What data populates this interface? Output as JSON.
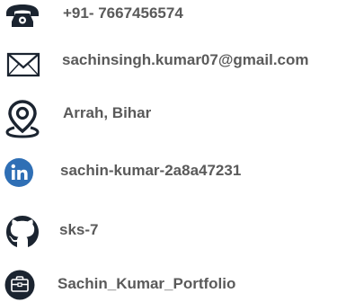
{
  "contact": {
    "phone": {
      "icon": "phone-icon",
      "text": "+91- 7667456574"
    },
    "email": {
      "icon": "envelope-icon",
      "text": "sachinsingh.kumar07@gmail.com"
    },
    "location": {
      "icon": "location-pin-icon",
      "text": "Arrah, Bihar"
    },
    "linkedin": {
      "icon": "linkedin-icon",
      "text": "sachin-kumar-2a8a47231",
      "brand_color": "#2f6fb5"
    },
    "github": {
      "icon": "github-icon",
      "text": "sks-7"
    },
    "portfolio": {
      "icon": "briefcase-icon",
      "text": "Sachin_Kumar_Portfolio"
    }
  },
  "colors": {
    "text": "#5a5a5a",
    "icon": "#1b2430",
    "linkedin": "#2f6fb5"
  }
}
